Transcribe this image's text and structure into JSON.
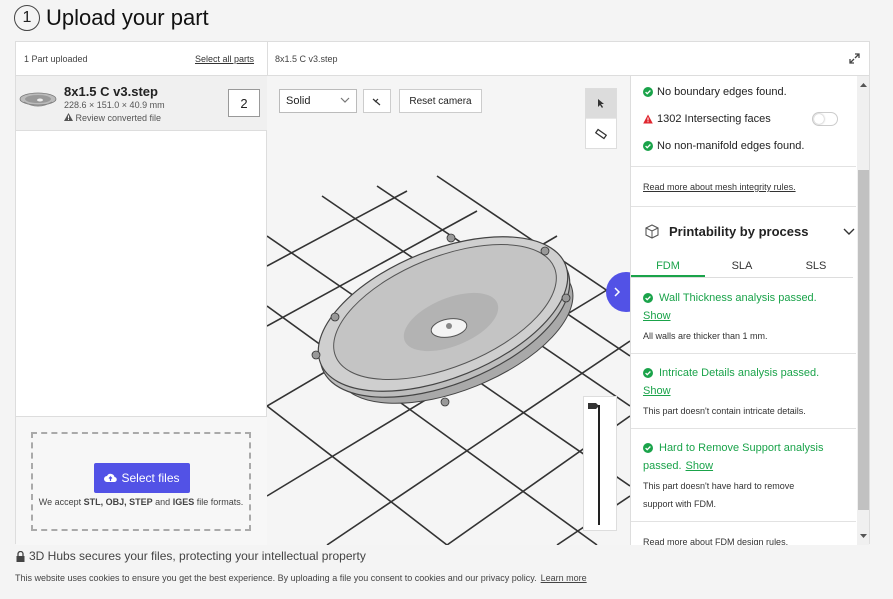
{
  "step": {
    "number": "1",
    "title": "Upload your part"
  },
  "topbar": {
    "count": "1 Part uploaded",
    "select_all": "Select all parts",
    "filename": "8x1.5 C v3.step"
  },
  "part": {
    "name": "8x1.5 C v3.step",
    "dims": "228.6 × 151.0 × 40.9 mm",
    "review": "Review converted file",
    "quantity": "2"
  },
  "upload": {
    "button": "Select files",
    "accept_prefix": "We accept ",
    "formats": "STL, OBJ, STEP",
    "accept_and": " and ",
    "format_last": "IGES",
    "accept_suffix": " file formats."
  },
  "viewer": {
    "render_mode": "Solid",
    "reset_camera": "Reset camera"
  },
  "integrity": {
    "checks": [
      {
        "text": "No boundary edges found.",
        "status": "ok"
      },
      {
        "text": "1302 Intersecting faces",
        "status": "warning"
      },
      {
        "text": "No non-manifold edges found.",
        "status": "ok"
      }
    ],
    "read_more": "Read more about mesh integrity rules."
  },
  "printability": {
    "title": "Printability by process",
    "tabs": [
      "FDM",
      "SLA",
      "SLS"
    ],
    "active_tab": "FDM",
    "results": [
      {
        "title": "Wall Thickness analysis passed.",
        "show": "Show",
        "desc": "All walls are thicker than 1 mm."
      },
      {
        "title": "Intricate Details analysis passed.",
        "show": "Show",
        "desc": "This part doesn't contain intricate details."
      },
      {
        "title_line1": "Hard to Remove Support analysis",
        "title_line2": "passed.",
        "show": "Show",
        "desc_line1": "This part doesn't have hard to remove",
        "desc_line2": "support with FDM."
      }
    ],
    "read_more": "Read more about FDM design rules."
  },
  "footer": {
    "secure": "3D Hubs secures your files, protecting your intellectual property",
    "cookies": "This website uses cookies to ensure you get the best experience. By uploading a file you consent to cookies and our privacy policy.",
    "learn_more": "Learn more"
  },
  "colors": {
    "accent": "#5252e6",
    "success": "#1aa34a",
    "warning": "#e0262f"
  }
}
